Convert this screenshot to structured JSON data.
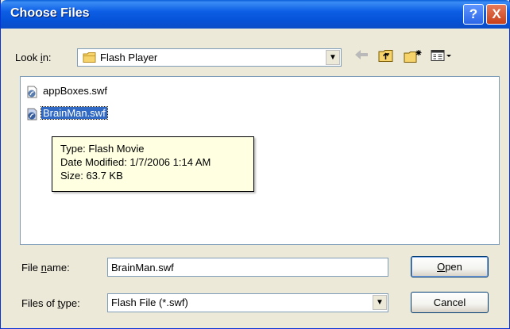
{
  "window": {
    "title": "Choose Files"
  },
  "titlebar": {
    "help_glyph": "?",
    "close_glyph": "X"
  },
  "lookin": {
    "label_pre": "Look ",
    "label_key": "i",
    "label_post": "n:",
    "value": "Flash Player"
  },
  "toolbar": {
    "back_icon": "back-arrow-icon",
    "up_icon": "up-folder-icon",
    "new_folder_icon": "new-folder-icon",
    "view_icon": "view-menu-icon"
  },
  "files": [
    {
      "name": "appBoxes.swf",
      "selected": false
    },
    {
      "name": "BrainMan.swf",
      "selected": true
    }
  ],
  "tooltip": {
    "type": "Type: Flash Movie",
    "modified": "Date Modified: 1/7/2006 1:14 AM",
    "size": "Size: 63.7 KB"
  },
  "filename": {
    "label_pre": "File ",
    "label_key": "n",
    "label_post": "ame:",
    "value": "BrainMan.swf"
  },
  "filetype": {
    "label_pre": "Files of ",
    "label_key": "t",
    "label_post": "ype:",
    "value": "Flash File (*.swf)"
  },
  "buttons": {
    "open_key": "O",
    "open_rest": "pen",
    "cancel": "Cancel"
  },
  "colors": {
    "selection": "#316ac5",
    "titlebar": "#0653d8",
    "tooltip_bg": "#ffffe1"
  }
}
